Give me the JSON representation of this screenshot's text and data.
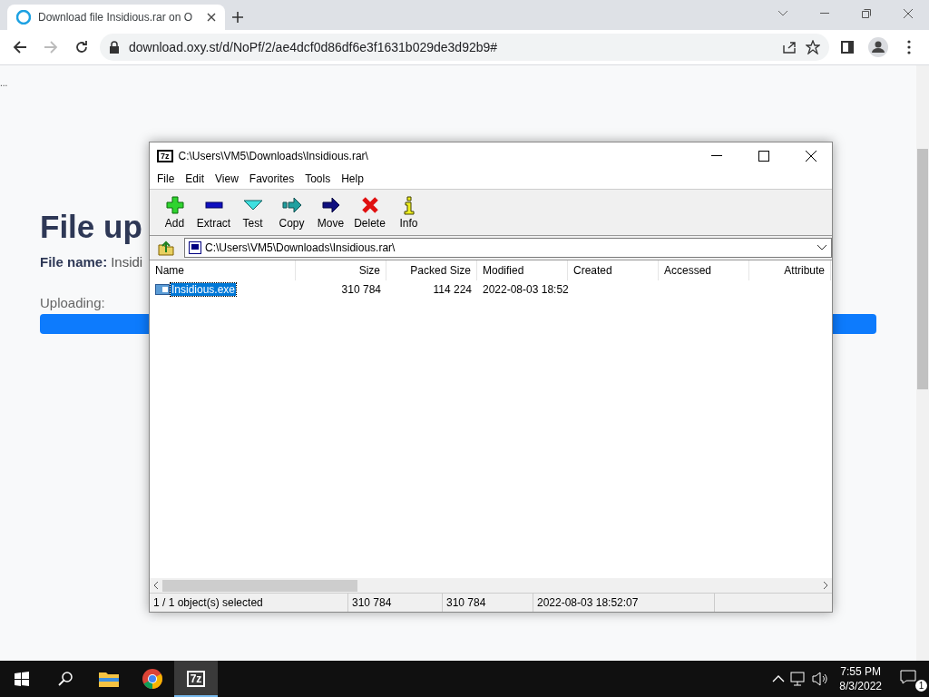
{
  "browser": {
    "tab": {
      "title": "Download file Insidious.rar on O",
      "selected": true
    },
    "address": "download.oxy.st/d/NoPf/2/ae4dcf0d86df6e3f1631b029de3d92b9#"
  },
  "page": {
    "corner_text": "...",
    "heading": "File up",
    "file_name_label": "File name:",
    "file_name_value": "Insidi",
    "uploading_label": "Uploading:",
    "progress": {
      "level": 1
    }
  },
  "archive_window": {
    "logo": "7z",
    "title": "C:\\Users\\VM5\\Downloads\\Insidious.rar\\",
    "menu": [
      "File",
      "Edit",
      "View",
      "Favorites",
      "Tools",
      "Help"
    ],
    "toolbar": [
      {
        "kind": "add",
        "label": "Add"
      },
      {
        "kind": "extract",
        "label": "Extract"
      },
      {
        "kind": "test",
        "label": "Test"
      },
      {
        "kind": "copy",
        "label": "Copy"
      },
      {
        "kind": "move",
        "label": "Move"
      },
      {
        "kind": "delete",
        "label": "Delete"
      },
      {
        "kind": "info",
        "label": "Info"
      }
    ],
    "path": "C:\\Users\\VM5\\Downloads\\Insidious.rar\\",
    "columns": [
      "Name",
      "Size",
      "Packed Size",
      "Modified",
      "Created",
      "Accessed",
      "Attribute"
    ],
    "rows": [
      {
        "selected": true,
        "cells": [
          "Insidious.exe",
          "310 784",
          "114 224",
          "2022-08-03 18:52",
          "",
          "",
          ""
        ]
      }
    ],
    "status": [
      "1 / 1 object(s) selected",
      "310 784",
      "310 784",
      "2022-08-03 18:52:07"
    ]
  },
  "taskbar": {
    "apps": [
      {
        "kind": "explorer",
        "selected": false
      },
      {
        "kind": "chrome",
        "selected": false
      },
      {
        "kind": "sevenzip",
        "label": "7z",
        "selected": true
      }
    ],
    "time": "7:55 PM",
    "date": "8/3/2022",
    "notifications": "1"
  }
}
